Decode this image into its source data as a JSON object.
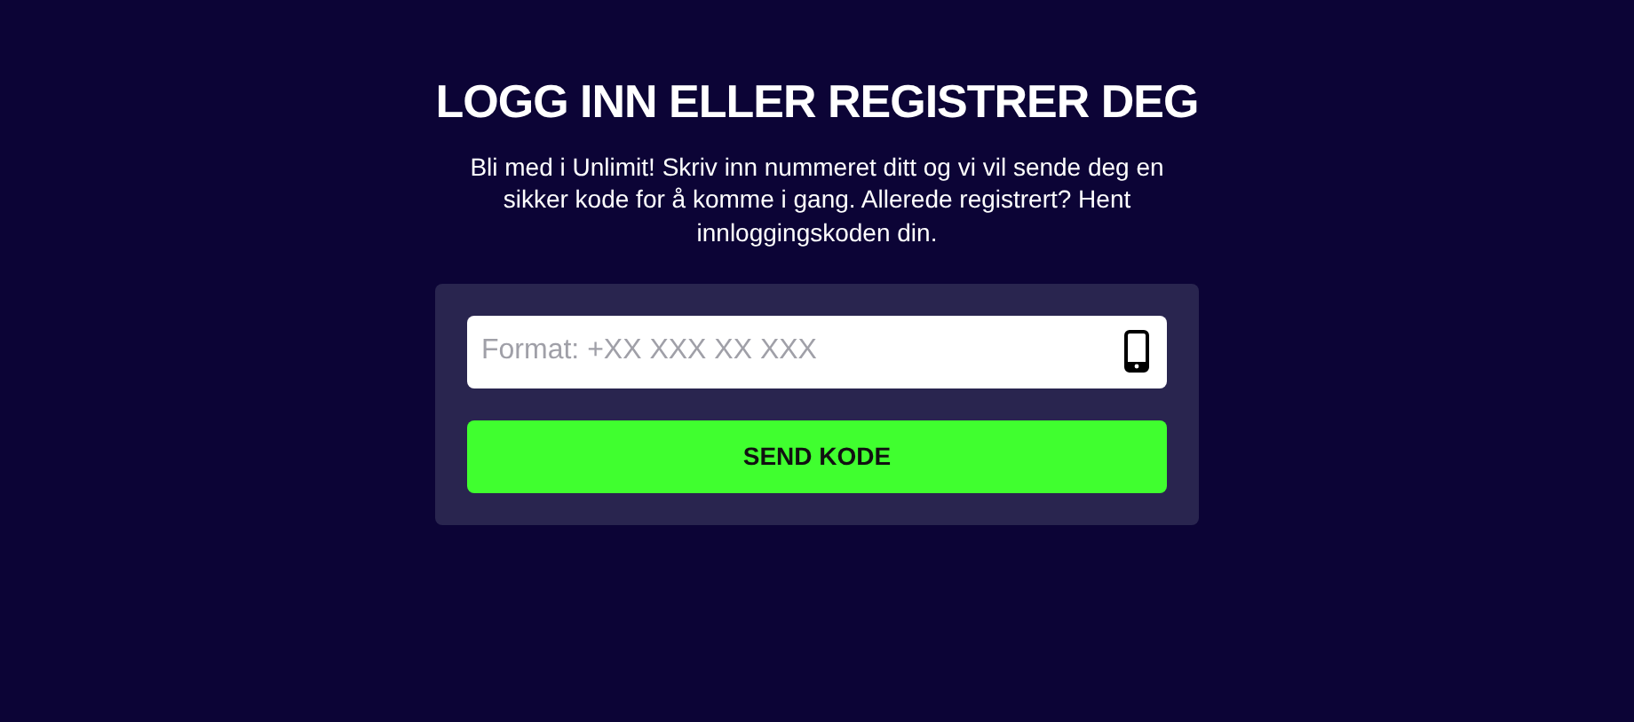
{
  "heading": "LOGG INN ELLER REGISTRER DEG",
  "intro": "Bli med i Unlimit! Skriv inn nummeret ditt og vi vil sende deg en sikker kode for å komme i gang. Allerede registrert? Hent innloggingskoden din.",
  "phone_field": {
    "placeholder": "Format: +XX XXX XX XXX"
  },
  "submit_button": "SEND KODE"
}
